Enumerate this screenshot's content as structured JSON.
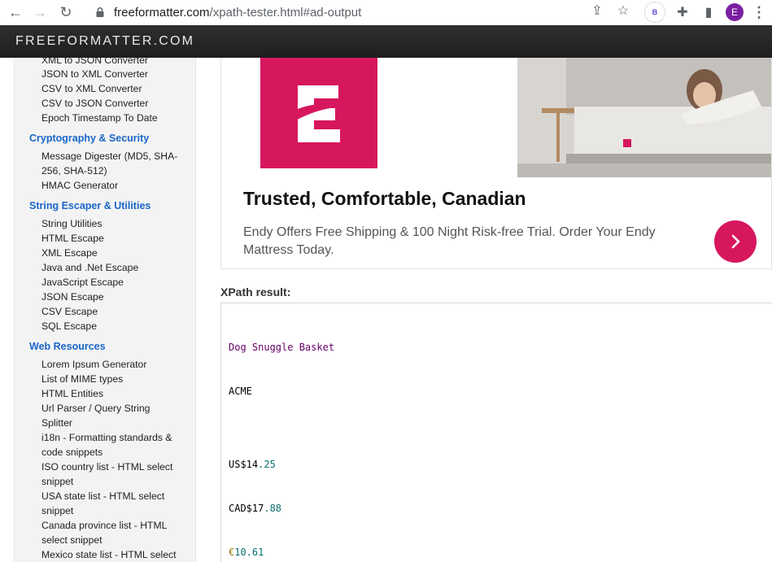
{
  "browser": {
    "url_host": "freeformatter.com",
    "url_path": "/xpath-tester.html#ad-output",
    "extension_badge": "B",
    "profile_initial": "E"
  },
  "site": {
    "logo": "FREEFORMATTER.COM"
  },
  "sidebar": {
    "top_links": [
      "XML to JSON Converter",
      "JSON to XML Converter",
      "CSV to XML Converter",
      "CSV to JSON Converter",
      "Epoch Timestamp To Date"
    ],
    "crypto_heading": "Cryptography & Security",
    "crypto_links": [
      "Message Digester (MD5, SHA-",
      "256, SHA-512)",
      "HMAC Generator"
    ],
    "string_heading": "String Escaper & Utilities",
    "string_links": [
      "String Utilities",
      "HTML Escape",
      "XML Escape",
      "Java and .Net Escape",
      "JavaScript Escape",
      "JSON Escape",
      "CSV Escape",
      "SQL Escape"
    ],
    "web_heading": "Web Resources",
    "web_links": [
      "Lorem Ipsum Generator",
      "List of MIME types",
      "HTML Entities",
      "Url Parser / Query String",
      "Splitter",
      "i18n - Formatting standards &",
      "code snippets",
      "ISO country list - HTML select",
      "snippet",
      "USA state list - HTML select",
      "snippet",
      "Canada province list - HTML",
      "select snippet",
      "Mexico state list - HTML select"
    ]
  },
  "ad": {
    "logo_letter": "E",
    "title": "Trusted, Comfortable, Canadian",
    "description": "Endy Offers Free Shipping & 100 Night Risk-free Trial. Order Your Endy Mattress Today.",
    "brand_color": "#d6175e"
  },
  "result": {
    "label": "XPath result:",
    "line1": "Dog Snuggle Basket",
    "line2": "ACME",
    "line3_prefix": "US$14",
    "line3_num": ".25",
    "line4_prefix": "CAD$17",
    "line4_num": ".88",
    "line5_symbol": "€",
    "line5_num": "10.61"
  }
}
